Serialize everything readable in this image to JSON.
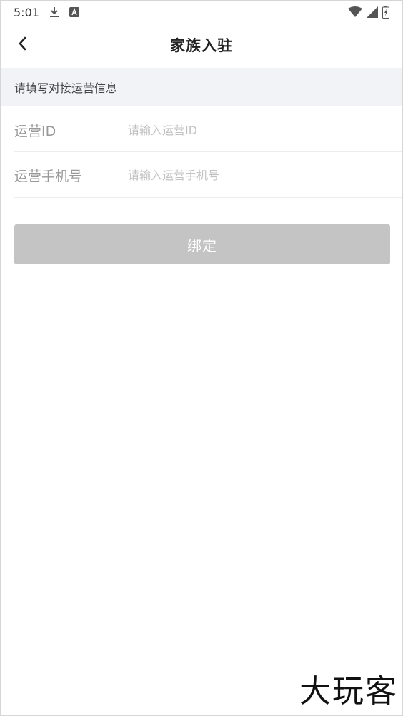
{
  "status_bar": {
    "time": "5:01",
    "icons": [
      "download-icon",
      "a-badge-icon",
      "wifi-icon",
      "signal-icon",
      "battery-icon"
    ]
  },
  "nav": {
    "title": "家族入驻",
    "back_icon": "chevron-left-icon"
  },
  "section": {
    "header": "请填写对接运营信息"
  },
  "form": {
    "fields": [
      {
        "label": "运营ID",
        "placeholder": "请输入运营ID",
        "value": ""
      },
      {
        "label": "运营手机号",
        "placeholder": "请输入运营手机号",
        "value": ""
      }
    ]
  },
  "actions": {
    "bind_label": "绑定"
  },
  "watermark": {
    "text": "大玩客"
  },
  "colors": {
    "section_bg": "#f2f3f7",
    "button_disabled": "#c4c4c4",
    "placeholder": "#c2c2c2"
  }
}
